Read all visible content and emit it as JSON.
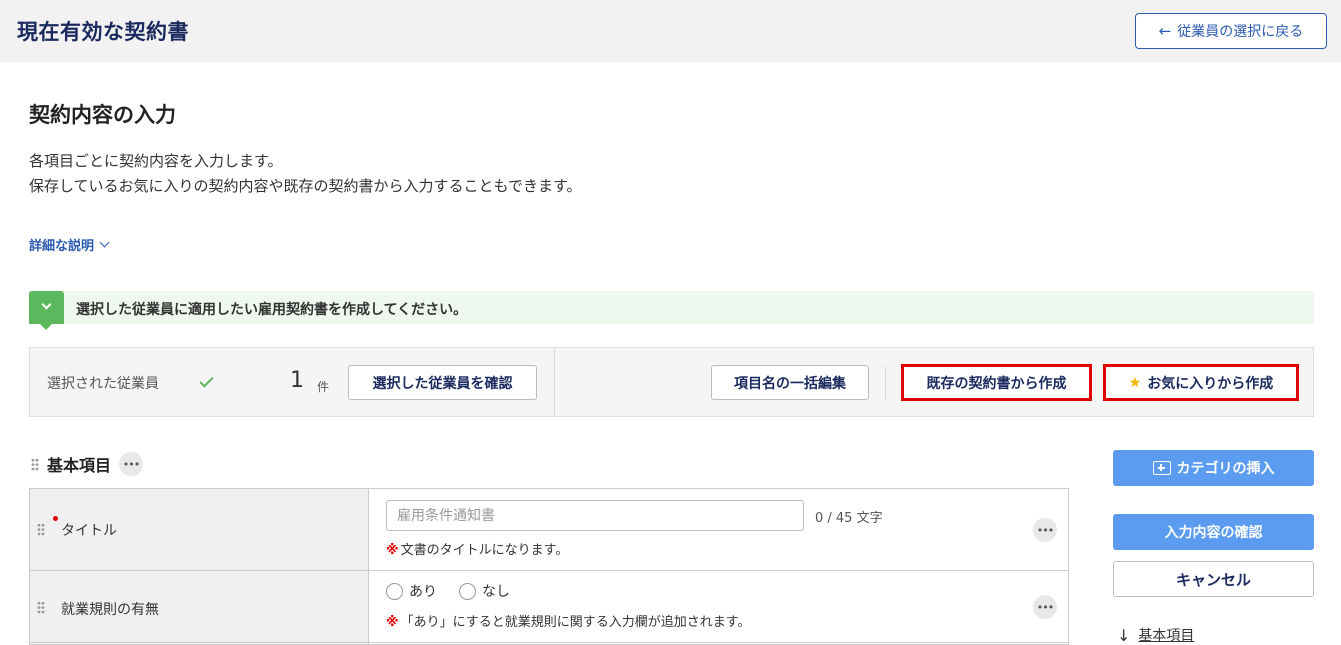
{
  "header": {
    "title": "現在有効な契約書",
    "back_button": "従業員の選択に戻る",
    "back_icon": "←"
  },
  "section": {
    "title": "契約内容の入力",
    "desc_line1": "各項目ごとに契約内容を入力します。",
    "desc_line2": "保存しているお気に入りの契約内容や既存の契約書から入力することもできます。",
    "detail_link": "詳細な説明"
  },
  "step_banner": {
    "text": "選択した従業員に適用したい雇用契約書を作成してください。"
  },
  "toolbar": {
    "selected_label": "選択された従業員",
    "count": "1",
    "count_unit": "件",
    "confirm_employees": "選択した従業員を確認",
    "bulk_edit": "項目名の一括編集",
    "from_existing": "既存の契約書から作成",
    "from_favorite": "お気に入りから作成",
    "star_icon": "★"
  },
  "basic": {
    "heading": "基本項目",
    "more_icon": "•••"
  },
  "rows": [
    {
      "label": "タイトル",
      "placeholder": "雇用条件通知書",
      "char_count": "0 / 45 文字",
      "note_mark": "※",
      "note": "文書のタイトルになります。"
    },
    {
      "label": "就業規則の有無",
      "options": [
        "あり",
        "なし"
      ],
      "note_mark": "※",
      "note": "「あり」にすると就業規則に関する入力欄が追加されます。"
    }
  ],
  "side": {
    "insert_category": "カテゴリの挿入",
    "confirm_input": "入力内容の確認",
    "cancel": "キャンセル",
    "jump_link": "基本項目",
    "down_arrow": "↓"
  }
}
